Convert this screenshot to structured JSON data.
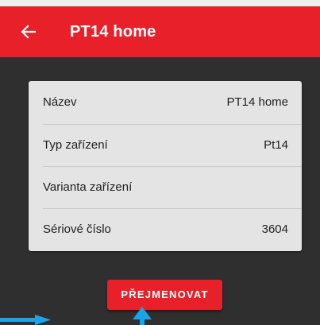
{
  "app_bar": {
    "title": "PT14 home",
    "back_icon": "arrow-left-icon",
    "color": "#e8202a"
  },
  "device_info": {
    "rows": [
      {
        "label": "Název",
        "value": "PT14 home"
      },
      {
        "label": "Typ zařízení",
        "value": "Pt14"
      },
      {
        "label": "Varianta zařízení",
        "value": ""
      },
      {
        "label": "Sériové číslo",
        "value": "3604"
      }
    ]
  },
  "actions": {
    "rename_label": "PŘEJMENOVAT"
  },
  "annotations": {
    "arrow_color": "#1aa3e8",
    "arrows": [
      "arrow-right-icon",
      "arrow-up-icon"
    ]
  }
}
